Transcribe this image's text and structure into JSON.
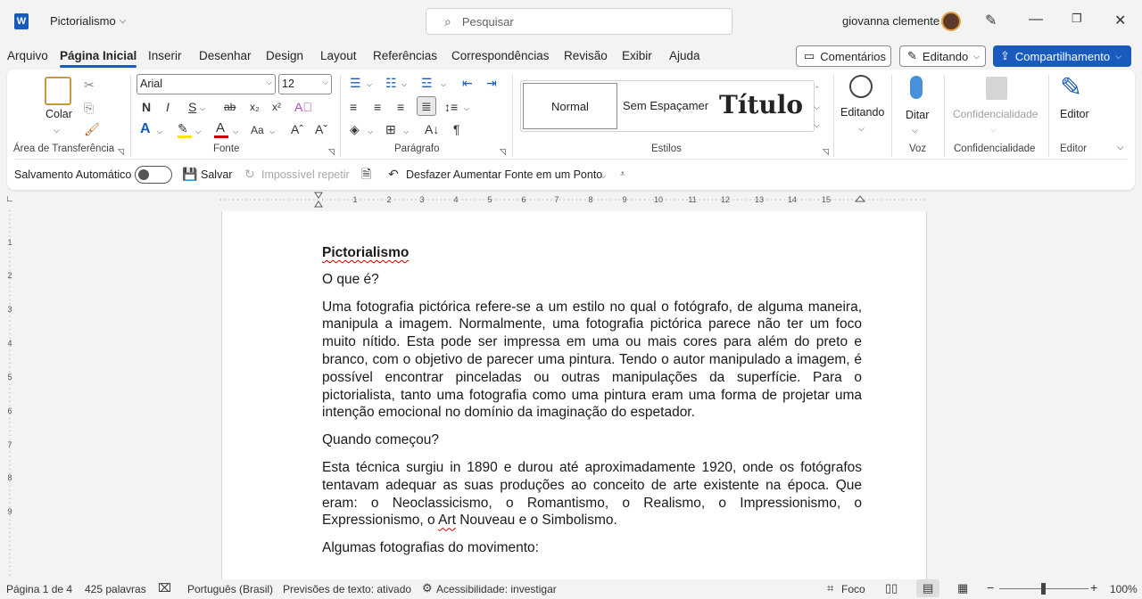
{
  "app": {
    "logo_letter": "W",
    "doc_title": "Pictorialismo",
    "user": "giovanna clemente"
  },
  "search": {
    "placeholder": "Pesquisar"
  },
  "menu": [
    "Arquivo",
    "Página Inicial",
    "Inserir",
    "Desenhar",
    "Design",
    "Layout",
    "Referências",
    "Correspondências",
    "Revisão",
    "Exibir",
    "Ajuda"
  ],
  "actions": {
    "comments": "Comentários",
    "editing": "Editando",
    "share": "Compartilhamento"
  },
  "ribbon": {
    "clipboard": {
      "paste": "Colar",
      "label": "Área de Transferência"
    },
    "font": {
      "family": "Arial",
      "size": "12",
      "label": "Fonte"
    },
    "paragraph": {
      "label": "Parágrafo"
    },
    "styles": {
      "normal": "Normal",
      "no_spacing": "Sem Espaçamer",
      "title": "Título",
      "label": "Estilos"
    },
    "editing": {
      "label": "Editando"
    },
    "voice": {
      "dictate": "Ditar",
      "label": "Voz"
    },
    "sensitivity": {
      "button": "Confidencialidade",
      "label": "Confidencialidade"
    },
    "editor": {
      "button": "Editor",
      "label": "Editor"
    }
  },
  "quick_access": {
    "autosave": "Salvamento Automático",
    "save": "Salvar",
    "redo": "Impossível repetir",
    "undo": "Desfazer Aumentar Fonte em um Ponto"
  },
  "ruler": {
    "h_numbers": [
      "1",
      "2",
      "3",
      "4",
      "5",
      "6",
      "7",
      "8",
      "9",
      "10",
      "11",
      "12",
      "13",
      "14",
      "15"
    ],
    "v_numbers": [
      "1",
      "2",
      "3",
      "4",
      "5",
      "6",
      "7",
      "8",
      "9"
    ]
  },
  "document": {
    "heading": "Pictorialismo",
    "q1": "O que é?",
    "p1": "Uma fotografia pictórica refere-se a um estilo no qual o fotógrafo, de alguma maneira, manipula a imagem. Normalmente, uma fotografia pictórica parece não ter um foco muito nítido. Esta pode ser impressa em uma ou mais cores para além do preto e branco, com o objetivo de parecer uma pintura. Tendo o autor manipulado a imagem, é possível encontrar pinceladas ou outras manipulações da superfície. Para o pictorialista, tanto uma fotografia como uma pintura eram uma forma de projetar uma intenção emocional no domínio da imaginação do espetador.",
    "q2": "Quando começou?",
    "p2_a": "Esta técnica surgiu in 1890 e durou até aproximadamente 1920, onde os fotógrafos tentavam adequar as suas produções ao conceito de arte existente na época. Que eram: o Neoclassicismo, o Romantismo, o Realismo, o Impressionismo, o Expressionismo, o ",
    "p2_spell": "Art",
    "p2_b": " Nouveau e o Simbolismo.",
    "q3": "Algumas fotografias do movimento:"
  },
  "status": {
    "page": "Página 1 de 4",
    "words": "425 palavras",
    "language": "Português (Brasil)",
    "predictions": "Previsões de texto: ativado",
    "accessibility": "Acessibilidade: investigar",
    "focus": "Foco",
    "zoom": "100%"
  },
  "colors": {
    "accent": "#185abd",
    "font_color": "#c00000",
    "highlight": "#ffe600"
  }
}
